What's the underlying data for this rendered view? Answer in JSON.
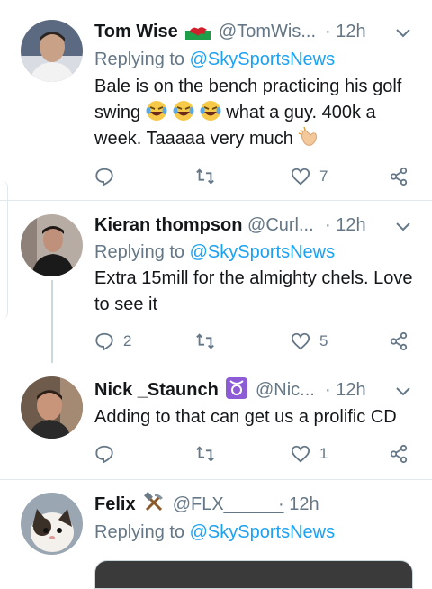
{
  "tweets": [
    {
      "name": "Tom Wise",
      "name_emoji": "wales-flag",
      "handle": "@TomWis...",
      "time": "· 12h",
      "replying_to_label": "Replying to",
      "mention": "@SkySportsNews",
      "text_1": "Bale is on the bench practicing his golf swing",
      "text_2": "what a guy. 400k a week. Taaaaa very much",
      "replies": "",
      "retweets": "",
      "likes": "7"
    },
    {
      "name": "Kieran thompson",
      "handle": "@Curl...",
      "time": "· 12h",
      "replying_to_label": "Replying to",
      "mention": "@SkySportsNews",
      "text": "Extra 15mill for the almighty chels. Love to see it",
      "replies": "2",
      "retweets": "",
      "likes": "5"
    },
    {
      "name": "Nick _Staunch",
      "name_emoji": "taurus-sign",
      "handle": "@Nic...",
      "time": "· 12h",
      "text": "Adding to that can get us a prolific CD",
      "replies": "",
      "retweets": "",
      "likes": "1"
    },
    {
      "name": "Felix",
      "name_emoji": "hammer-and-pick",
      "handle": "@FLX______",
      "time": "· 12h",
      "replying_to_label": "Replying to",
      "mention": "@SkySportsNews"
    }
  ],
  "colors": {
    "link": "#1da1f2",
    "secondary_text": "#657786",
    "divider": "#e1e8ed"
  }
}
